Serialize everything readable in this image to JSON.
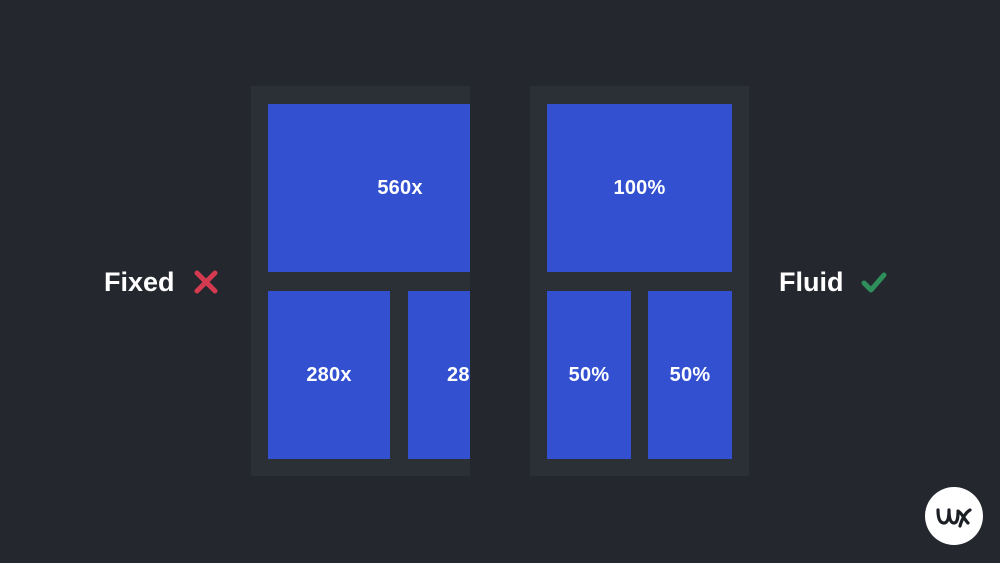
{
  "labels": {
    "fixed": "Fixed",
    "fluid": "Fluid"
  },
  "fixed_frame": {
    "top_block": "560x",
    "bottom_left_block": "280x",
    "bottom_right_block": "28"
  },
  "fluid_frame": {
    "top_block": "100%",
    "bottom_left_block": "50%",
    "bottom_right_block": "50%"
  },
  "icons": {
    "fixed_mark": "cross-icon",
    "fluid_mark": "check-icon",
    "logo": "ux-logo"
  },
  "colors": {
    "background": "#24282e",
    "frame": "#2b2f36",
    "block": "#3250d0",
    "cross": "#d33a50",
    "check": "#2e8f5a",
    "text": "#ffffff"
  }
}
